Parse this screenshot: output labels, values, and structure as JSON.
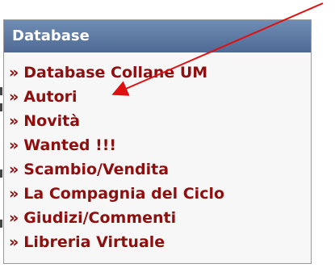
{
  "panel": {
    "title": "Database",
    "bullet": "»",
    "items": [
      {
        "label": "Database Collane UM"
      },
      {
        "label": "Autori"
      },
      {
        "label": "Novità"
      },
      {
        "label": "Wanted !!!"
      },
      {
        "label": "Scambio/Vendita"
      },
      {
        "label": "La Compagnia del Ciclo"
      },
      {
        "label": "Giudizi/Commenti"
      },
      {
        "label": "Libreria Virtuale"
      }
    ]
  },
  "annotation": {
    "type": "arrow",
    "color": "#e01010",
    "target": "Autori"
  },
  "colors": {
    "header_bg": "#5a77a3",
    "header_text": "#ffffff",
    "link": "#8e0f0f",
    "panel_bg": "#f7f7f7"
  }
}
